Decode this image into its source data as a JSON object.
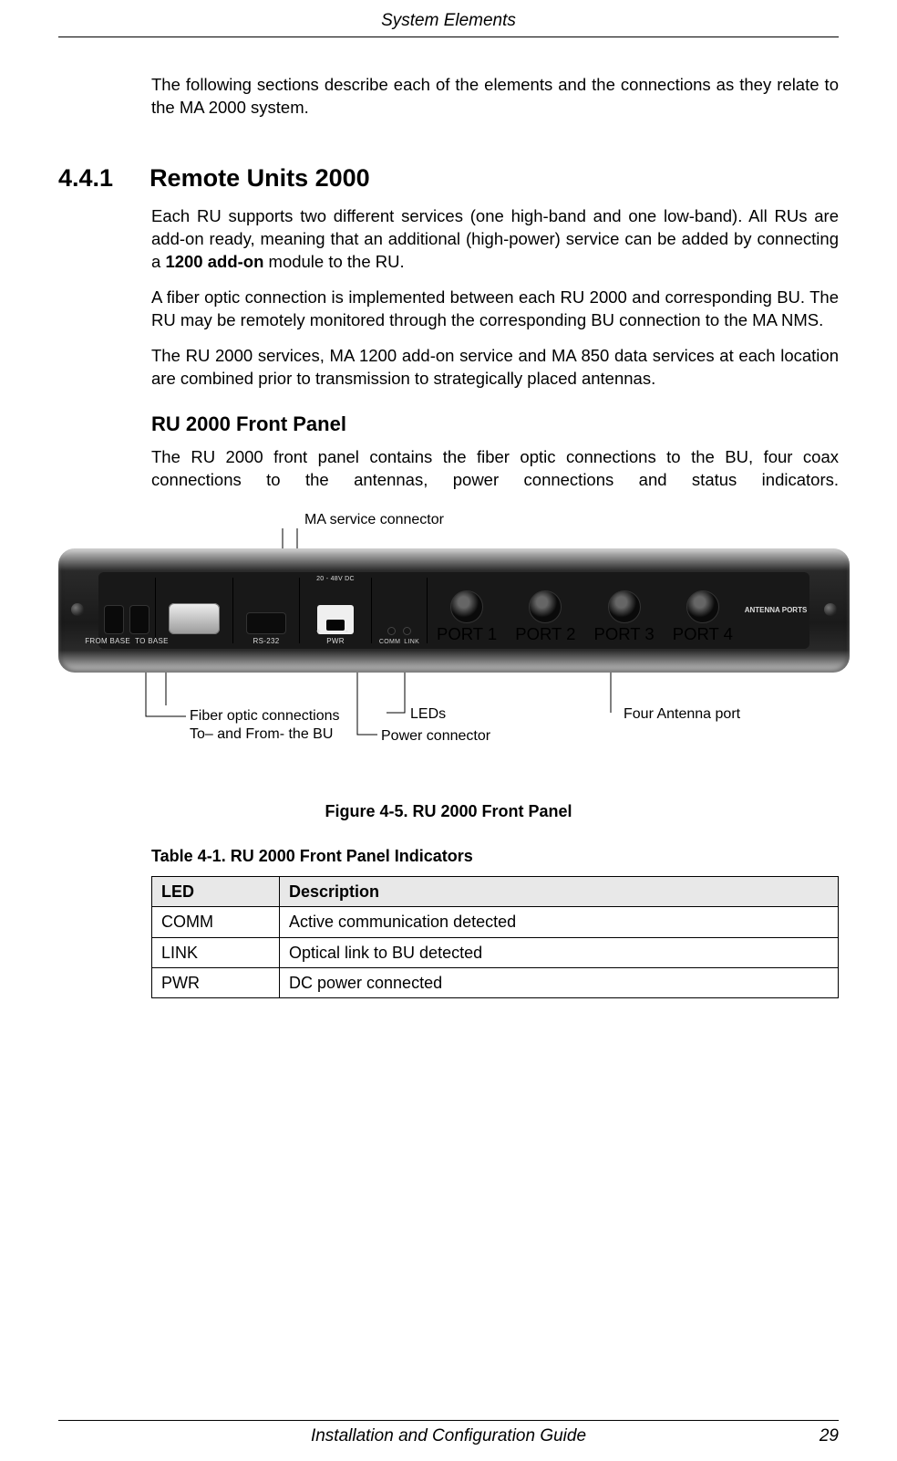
{
  "header": {
    "title": "System Elements"
  },
  "footer": {
    "title": "Installation and Configuration Guide",
    "page": "29"
  },
  "intro": "The following sections describe each of the elements and the connections as they relate to the MA 2000 system.",
  "section": {
    "number": "4.4.1",
    "title": "Remote Units 2000",
    "p1a": "Each RU supports two different services (one high-band and one low-band).  All RUs are add-on ready, meaning that an additional (high-power) service can be added by connecting a ",
    "p1_bold": "1200 add-on",
    "p1b": " module to the RU.",
    "p2": "A fiber optic connection is implemented between each RU 2000 and corresponding BU. The RU may be remotely monitored through the corresponding BU connection to the MA NMS.",
    "p3": "The RU 2000 services, MA 1200 add-on service and MA 850 data services at each location are combined prior to transmission to strategically placed antennas.",
    "sub_title": "RU 2000 Front Panel",
    "sub_p": "The RU 2000 front panel contains the fiber optic connections to the BU, four coax connections to the antennas, power connections and status indicators."
  },
  "figure": {
    "callout_top": "MA service connector",
    "callout_fiber_l1": "Fiber optic connections",
    "callout_fiber_l2": "To– and From- the BU",
    "callout_leds": "LEDs",
    "callout_power": "Power connector",
    "callout_antenna": "Four Antenna port",
    "caption": "Figure 4-5. RU 2000 Front Panel",
    "labels": {
      "from_base": "FROM BASE",
      "to_base": "TO BASE",
      "rs232": "RS-232",
      "dc": "20 - 48V DC",
      "plus": "+",
      "minus": "-",
      "pwr": "PWR",
      "comm": "COMM",
      "link": "LINK",
      "port1": "PORT 1",
      "port2": "PORT 2",
      "port3": "PORT 3",
      "port4": "PORT 4",
      "ant": "ANTENNA PORTS"
    }
  },
  "table": {
    "caption": "Table 4-1. RU 2000 Front Panel Indicators",
    "headers": {
      "c1": "LED",
      "c2": "Description"
    },
    "rows": [
      {
        "led": "COMM",
        "desc": "Active communication detected"
      },
      {
        "led": "LINK",
        "desc": "Optical link to BU detected"
      },
      {
        "led": "PWR",
        "desc": "DC power connected"
      }
    ]
  }
}
